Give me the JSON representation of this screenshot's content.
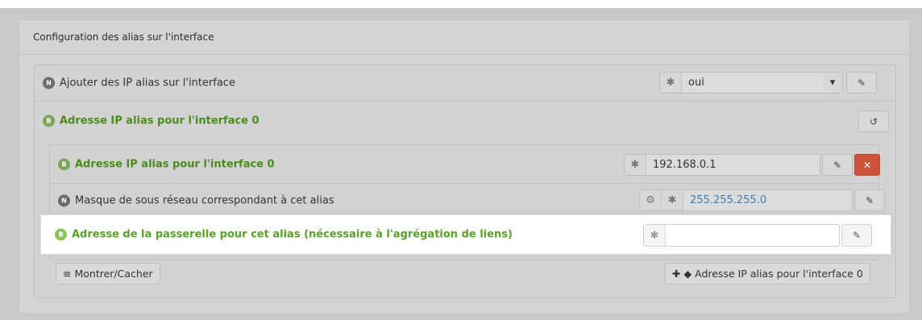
{
  "panel": {
    "title": "Configuration des alias sur l'interface"
  },
  "rows": {
    "add_alias": {
      "badge": "N",
      "label": "Ajouter des IP alias sur l'interface",
      "value": "oui",
      "addon_icon": "✱",
      "caret": "▾",
      "edit_icon": "✎"
    },
    "alias_group": {
      "badge": "B",
      "label": "Adresse IP alias pour l'interface 0",
      "reset_icon": "↺"
    },
    "alias_ip": {
      "badge": "B",
      "label": "Adresse IP alias pour l'interface 0",
      "value": "192.168.0.1",
      "addon_icon": "✱",
      "edit_icon": "✎",
      "remove_icon": "✕"
    },
    "netmask": {
      "badge": "N",
      "label": "Masque de sous réseau correspondant à cet alias",
      "value": "255.255.255.0",
      "gear_icon": "⚙",
      "addon_icon": "✱",
      "edit_icon": "✎"
    },
    "gateway": {
      "badge": "B",
      "label": "Adresse de la passerelle pour cet alias (nécessaire à l'agrégation de liens)",
      "value": "",
      "addon_icon": "✱",
      "edit_icon": "✎"
    }
  },
  "footer": {
    "toggle_label": "Montrer/Cacher",
    "toggle_icon": "≡",
    "add_label": "Adresse IP alias pour l'interface 0",
    "add_icon": "✚",
    "tag_icon": "◆"
  },
  "colors": {
    "green_label": "#4a8c1c",
    "value_blue": "#3d7fb3",
    "remove_red": "#c9543b"
  }
}
